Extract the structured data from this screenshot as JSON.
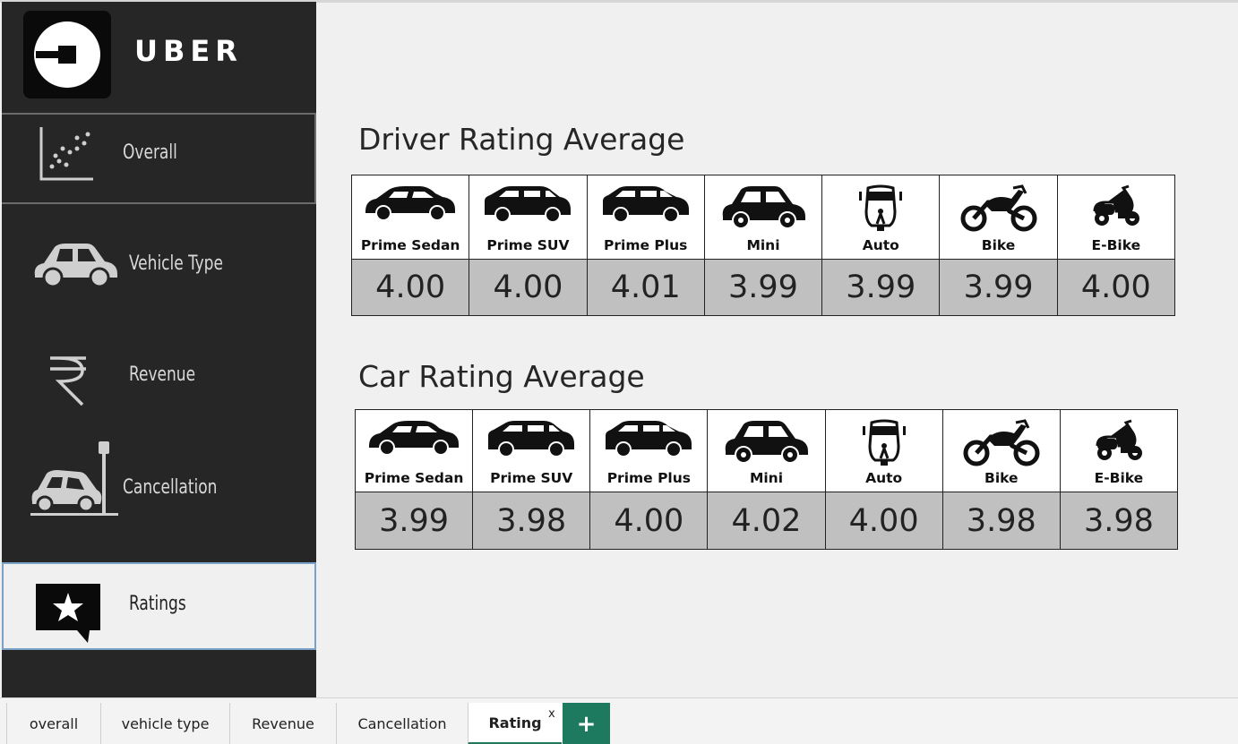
{
  "sidebar": {
    "brand": "UBER",
    "items": [
      {
        "label": "Overall",
        "icon": "scatter-chart-icon"
      },
      {
        "label": "Vehicle Type",
        "icon": "car-icon"
      },
      {
        "label": "Revenue",
        "icon": "rupee-icon"
      },
      {
        "label": "Cancellation",
        "icon": "car-crash-icon"
      },
      {
        "label": "Ratings",
        "icon": "star-speech-bubble-icon",
        "selected": true
      }
    ]
  },
  "driver_rating": {
    "title": "Driver Rating Average",
    "items": [
      {
        "name": "Prime Sedan",
        "value": "4.00",
        "icon": "sedan-icon"
      },
      {
        "name": "Prime SUV",
        "value": "4.00",
        "icon": "suv-icon"
      },
      {
        "name": "Prime Plus",
        "value": "4.01",
        "icon": "hatchback-icon"
      },
      {
        "name": "Mini",
        "value": "3.99",
        "icon": "mini-car-icon"
      },
      {
        "name": "Auto",
        "value": "3.99",
        "icon": "auto-rickshaw-icon"
      },
      {
        "name": "Bike",
        "value": "3.99",
        "icon": "motorbike-icon"
      },
      {
        "name": "E-Bike",
        "value": "4.00",
        "icon": "scooter-icon"
      }
    ]
  },
  "car_rating": {
    "title": "Car Rating Average",
    "items": [
      {
        "name": "Prime Sedan",
        "value": "3.99",
        "icon": "sedan-icon"
      },
      {
        "name": "Prime SUV",
        "value": "3.98",
        "icon": "suv-icon"
      },
      {
        "name": "Prime Plus",
        "value": "4.00",
        "icon": "hatchback-icon"
      },
      {
        "name": "Mini",
        "value": "4.02",
        "icon": "mini-car-icon"
      },
      {
        "name": "Auto",
        "value": "4.00",
        "icon": "auto-rickshaw-icon"
      },
      {
        "name": "Bike",
        "value": "3.98",
        "icon": "motorbike-icon"
      },
      {
        "name": "E-Bike",
        "value": "3.98",
        "icon": "scooter-icon"
      }
    ]
  },
  "tabs": {
    "items": [
      {
        "label": "overall"
      },
      {
        "label": "vehicle type"
      },
      {
        "label": "Revenue"
      },
      {
        "label": "Cancellation"
      },
      {
        "label": "Rating",
        "active": true
      }
    ],
    "close_label": "x",
    "add_label": "+"
  },
  "colors": {
    "sidebar_bg": "#262626",
    "accent_green": "#1e7a5e",
    "value_cell_bg": "#c0c0c0"
  }
}
